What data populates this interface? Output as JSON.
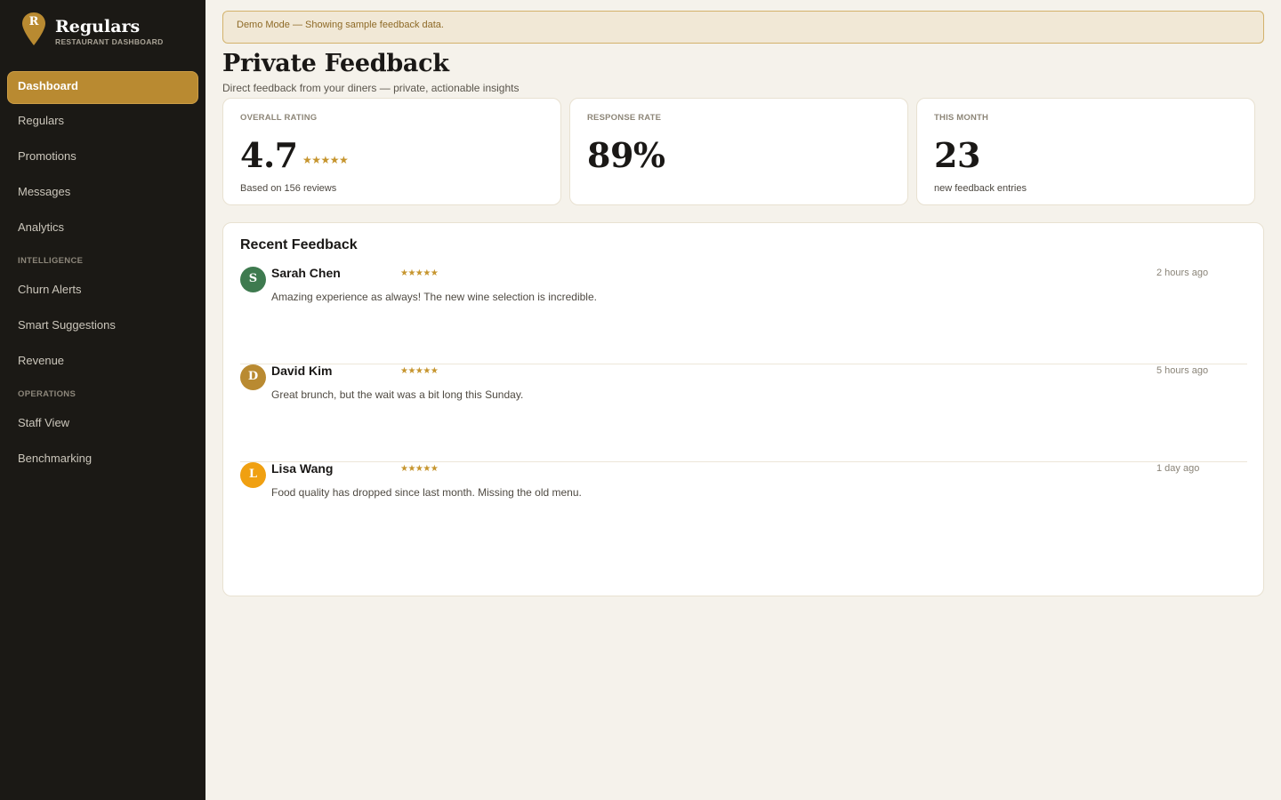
{
  "brand": {
    "initial": "R",
    "title": "Regulars",
    "subtitle": "RESTAURANT DASHBOARD",
    "accent_color": "#b98a31"
  },
  "nav": {
    "main": [
      {
        "label": "Dashboard",
        "active": true
      },
      {
        "label": "Regulars"
      },
      {
        "label": "Promotions"
      },
      {
        "label": "Messages"
      },
      {
        "label": "Analytics"
      }
    ],
    "intelligence_header": "INTELLIGENCE",
    "intelligence": [
      {
        "label": "Churn Alerts"
      },
      {
        "label": "Smart Suggestions"
      },
      {
        "label": "Revenue"
      }
    ],
    "operations_header": "OPERATIONS",
    "operations": [
      {
        "label": "Staff View"
      },
      {
        "label": "Benchmarking"
      }
    ]
  },
  "banner": "Demo Mode — Showing sample feedback data.",
  "page": {
    "title": "Private Feedback",
    "subtitle": "Direct feedback from your diners — private, actionable insights"
  },
  "stats": [
    {
      "label": "OVERALL RATING",
      "value": "4.7",
      "stars": "★★★★★",
      "note": "Based on 156 reviews"
    },
    {
      "label": "RESPONSE RATE",
      "value": "89%",
      "note": ""
    },
    {
      "label": "THIS MONTH",
      "value": "23",
      "note": "new feedback entries"
    }
  ],
  "feedback": {
    "title": "Recent Feedback",
    "items": [
      {
        "initial": "S",
        "name": "Sarah Chen",
        "stars": "★★★★★",
        "time": "2 hours ago",
        "text": "Amazing experience as always! The new wine selection is incredible.",
        "avatar_color": "#3e7a4f"
      },
      {
        "initial": "D",
        "name": "David Kim",
        "stars": "★★★★★",
        "time": "5 hours ago",
        "text": "Great brunch, but the wait was a bit long this Sunday.",
        "avatar_color": "#b98a31"
      },
      {
        "initial": "L",
        "name": "Lisa Wang",
        "stars": "★★★★★",
        "time": "1 day ago",
        "text": "Food quality has dropped since last month. Missing the old menu.",
        "avatar_color": "#f0a011"
      }
    ]
  }
}
